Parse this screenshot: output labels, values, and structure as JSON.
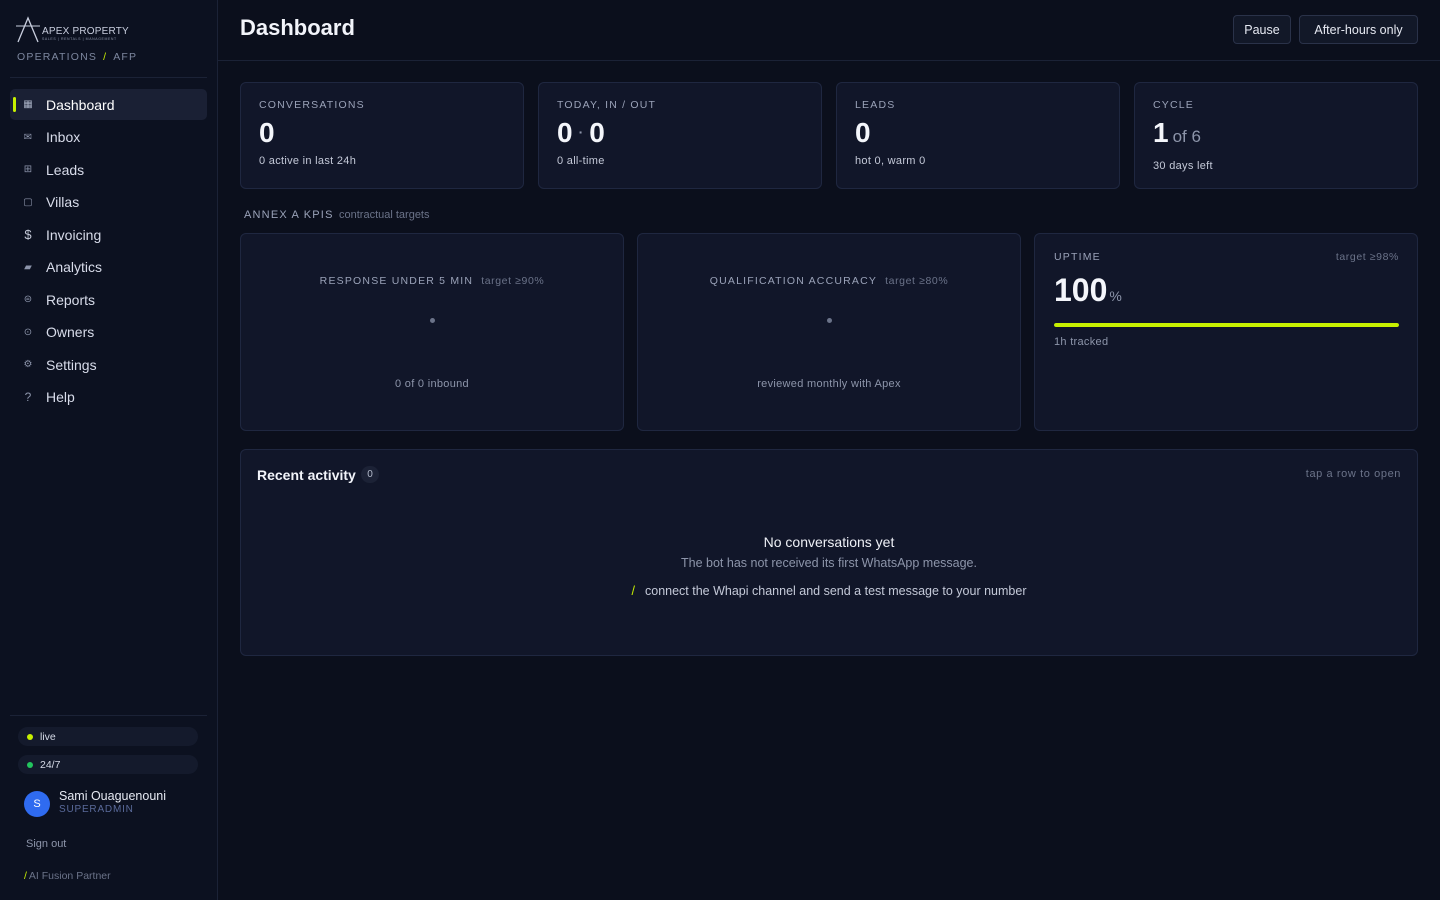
{
  "brand": {
    "name": "APEX PROPERTY",
    "tagline": "SALES | RENTALS | MANAGEMENT",
    "crumb_section": "OPERATIONS",
    "crumb_separator": "/",
    "crumb_code": "AFP",
    "accent_color": "#c7f000"
  },
  "sidebar": {
    "items": [
      {
        "label": "Dashboard",
        "icon": "grid-icon",
        "active": true
      },
      {
        "label": "Inbox",
        "icon": "mail-icon"
      },
      {
        "label": "Leads",
        "icon": "table-icon"
      },
      {
        "label": "Villas",
        "icon": "square-icon"
      },
      {
        "label": "Invoicing",
        "icon": "dollar-icon"
      },
      {
        "label": "Analytics",
        "icon": "chart-icon"
      },
      {
        "label": "Reports",
        "icon": "list-icon"
      },
      {
        "label": "Owners",
        "icon": "user-circle-icon"
      },
      {
        "label": "Settings",
        "icon": "gear-icon"
      },
      {
        "label": "Help",
        "icon": "question-icon"
      }
    ],
    "status_live": "live",
    "status_always": "24/7",
    "status_live_color": "#c7f000",
    "status_always_color": "#22c55e",
    "user": {
      "initial": "S",
      "name": "Sami Ouaguenouni",
      "role": "SUPERADMIN",
      "avatar_color": "#2f6bf0"
    },
    "sign_out": "Sign out",
    "partner_separator": "/",
    "partner": "AI Fusion Partner"
  },
  "header": {
    "title": "Dashboard",
    "pause_label": "Pause",
    "after_hours_label": "After-hours only"
  },
  "stats": {
    "conversations": {
      "label": "CONVERSATIONS",
      "value": "0",
      "sub": "0 active in last 24h"
    },
    "today": {
      "label": "TODAY, IN / OUT",
      "in": "0",
      "separator": "·",
      "out": "0",
      "sub": "0 all-time"
    },
    "leads": {
      "label": "LEADS",
      "value": "0",
      "sub": "hot 0, warm 0"
    },
    "cycle": {
      "label": "CYCLE",
      "value": "1",
      "of": "of 6",
      "sub": "30 days left"
    }
  },
  "kpis": {
    "section_title": "ANNEX A KPIS",
    "section_note": "contractual targets",
    "response": {
      "title": "RESPONSE UNDER 5 MIN",
      "target": "target ≥90%",
      "foot": "0 of 0 inbound"
    },
    "qualification": {
      "title": "QUALIFICATION ACCURACY",
      "target": "target ≥80%",
      "foot": "reviewed monthly with Apex"
    },
    "uptime": {
      "title": "UPTIME",
      "target": "target ≥98%",
      "value": "100",
      "unit": "%",
      "progress": 1.0,
      "sub": "1h tracked"
    }
  },
  "activity": {
    "title": "Recent activity",
    "count": "0",
    "hint": "tap a row to open",
    "empty_title": "No conversations yet",
    "empty_sub": "The bot has not received its first WhatsApp message.",
    "hint_separator": "/",
    "empty_hint": "connect the Whapi channel and send a test message to your number"
  }
}
